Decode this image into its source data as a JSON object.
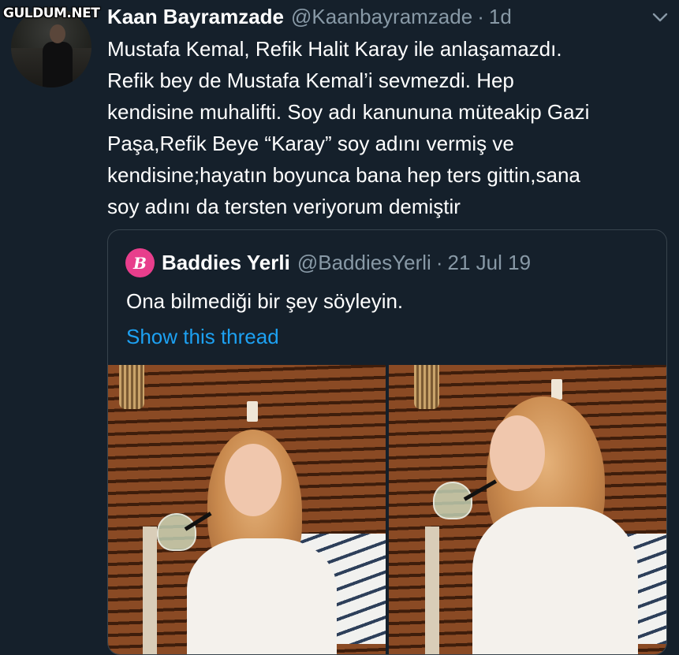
{
  "watermark": "GULDUM.NET",
  "tweet": {
    "display_name": "Kaan Bayramzade",
    "handle": "@Kaanbayramzade",
    "separator": "·",
    "time": "1d",
    "text_lines": [
      "Mustafa Kemal, Refik Halit Karay ile anlaşamazdı.",
      "Refik bey de Mustafa Kemal’i sevmezdi. Hep",
      "kendisine muhalifti. Soy adı kanununa müteakip Gazi",
      "Paşa,Refik Beye “Karay” soy adını vermiş ve",
      "kendisine;hayatın boyunca bana hep ters gittin,sana",
      "soy adını da tersten veriyorum demiştir"
    ],
    "menu_icon": "chevron-down-icon"
  },
  "quote": {
    "avatar_letter": "B",
    "display_name": "Baddies Yerli",
    "handle": "@BaddiesYerli",
    "separator": "·",
    "time": "21 Jul 19",
    "text": "Ona bilmediği bir şey söyleyin.",
    "show_thread": "Show this thread"
  },
  "colors": {
    "background": "#15202b",
    "secondary_text": "#8899a6",
    "link": "#1da1f2",
    "border": "#38444d",
    "quote_avatar": "#e83e8c"
  }
}
